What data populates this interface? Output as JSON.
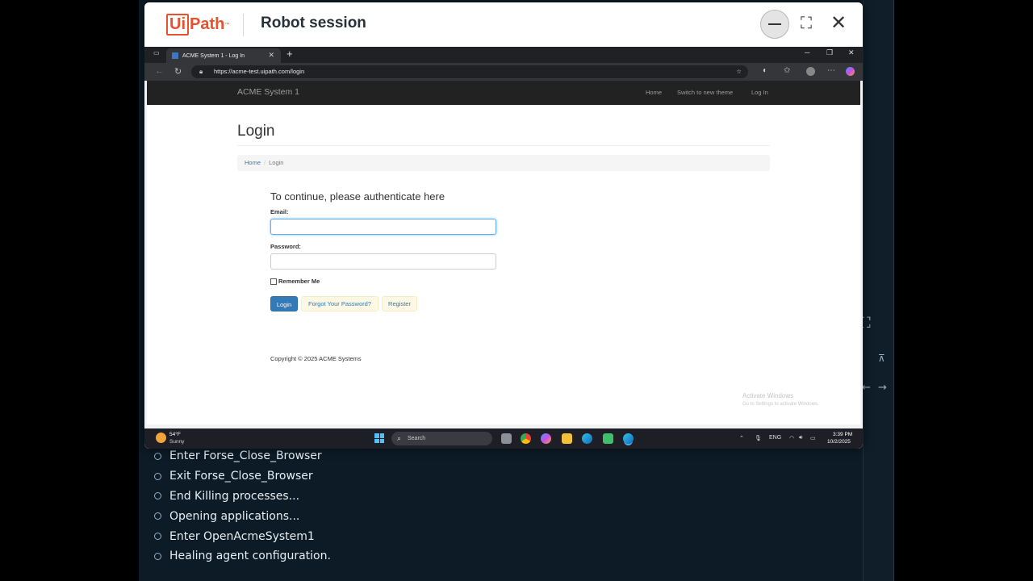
{
  "modal": {
    "logo_ui": "Ui",
    "logo_path": "Path",
    "logo_tm": "™",
    "title": "Robot session",
    "minimize_icon": "minimize-icon",
    "maximize_icon": "⛶",
    "close_icon": "✕"
  },
  "browser": {
    "tab_title": "ACME System 1 - Log In",
    "tab_close": "✕",
    "new_tab": "+",
    "url": "https://acme-test.uipath.com/login",
    "win_min": "─",
    "win_max": "❐",
    "win_close": "✕"
  },
  "site": {
    "brand": "ACME System 1",
    "nav": [
      "Home",
      "Switch to new theme",
      "Log In"
    ],
    "heading": "Login",
    "breadcrumb": [
      "Home",
      "Login"
    ],
    "breadcrumb_sep": "/",
    "subheading": "To continue, please authenticate here",
    "email_label": "Email:",
    "email_value": "",
    "password_label": "Password:",
    "password_value": "",
    "remember_label": "Remember Me",
    "login_button": "Login",
    "forgot_link": "Forgot Your Password?",
    "register_link": "Register",
    "footer": "Copyright © 2025 ACME Systems"
  },
  "watermark": {
    "line1": "Activate Windows",
    "line2": "Go to Settings to activate Windows."
  },
  "taskbar": {
    "temperature": "54°F",
    "weather": "Sunny",
    "search_placeholder": "Search",
    "language": "ENG",
    "time": "3:39 PM",
    "date": "10/2/2025"
  },
  "log": [
    "Enter Forse_Close_Browser",
    "Exit Forse_Close_Browser",
    "End Killing processes...",
    "Opening applications...",
    "Enter OpenAcmeSystem1",
    "Healing agent configuration."
  ],
  "colors": {
    "uipath_orange": "#e8512d",
    "bootstrap_primary": "#337ab7",
    "navbar": "#222222",
    "background_panel": "#0d1b26"
  }
}
